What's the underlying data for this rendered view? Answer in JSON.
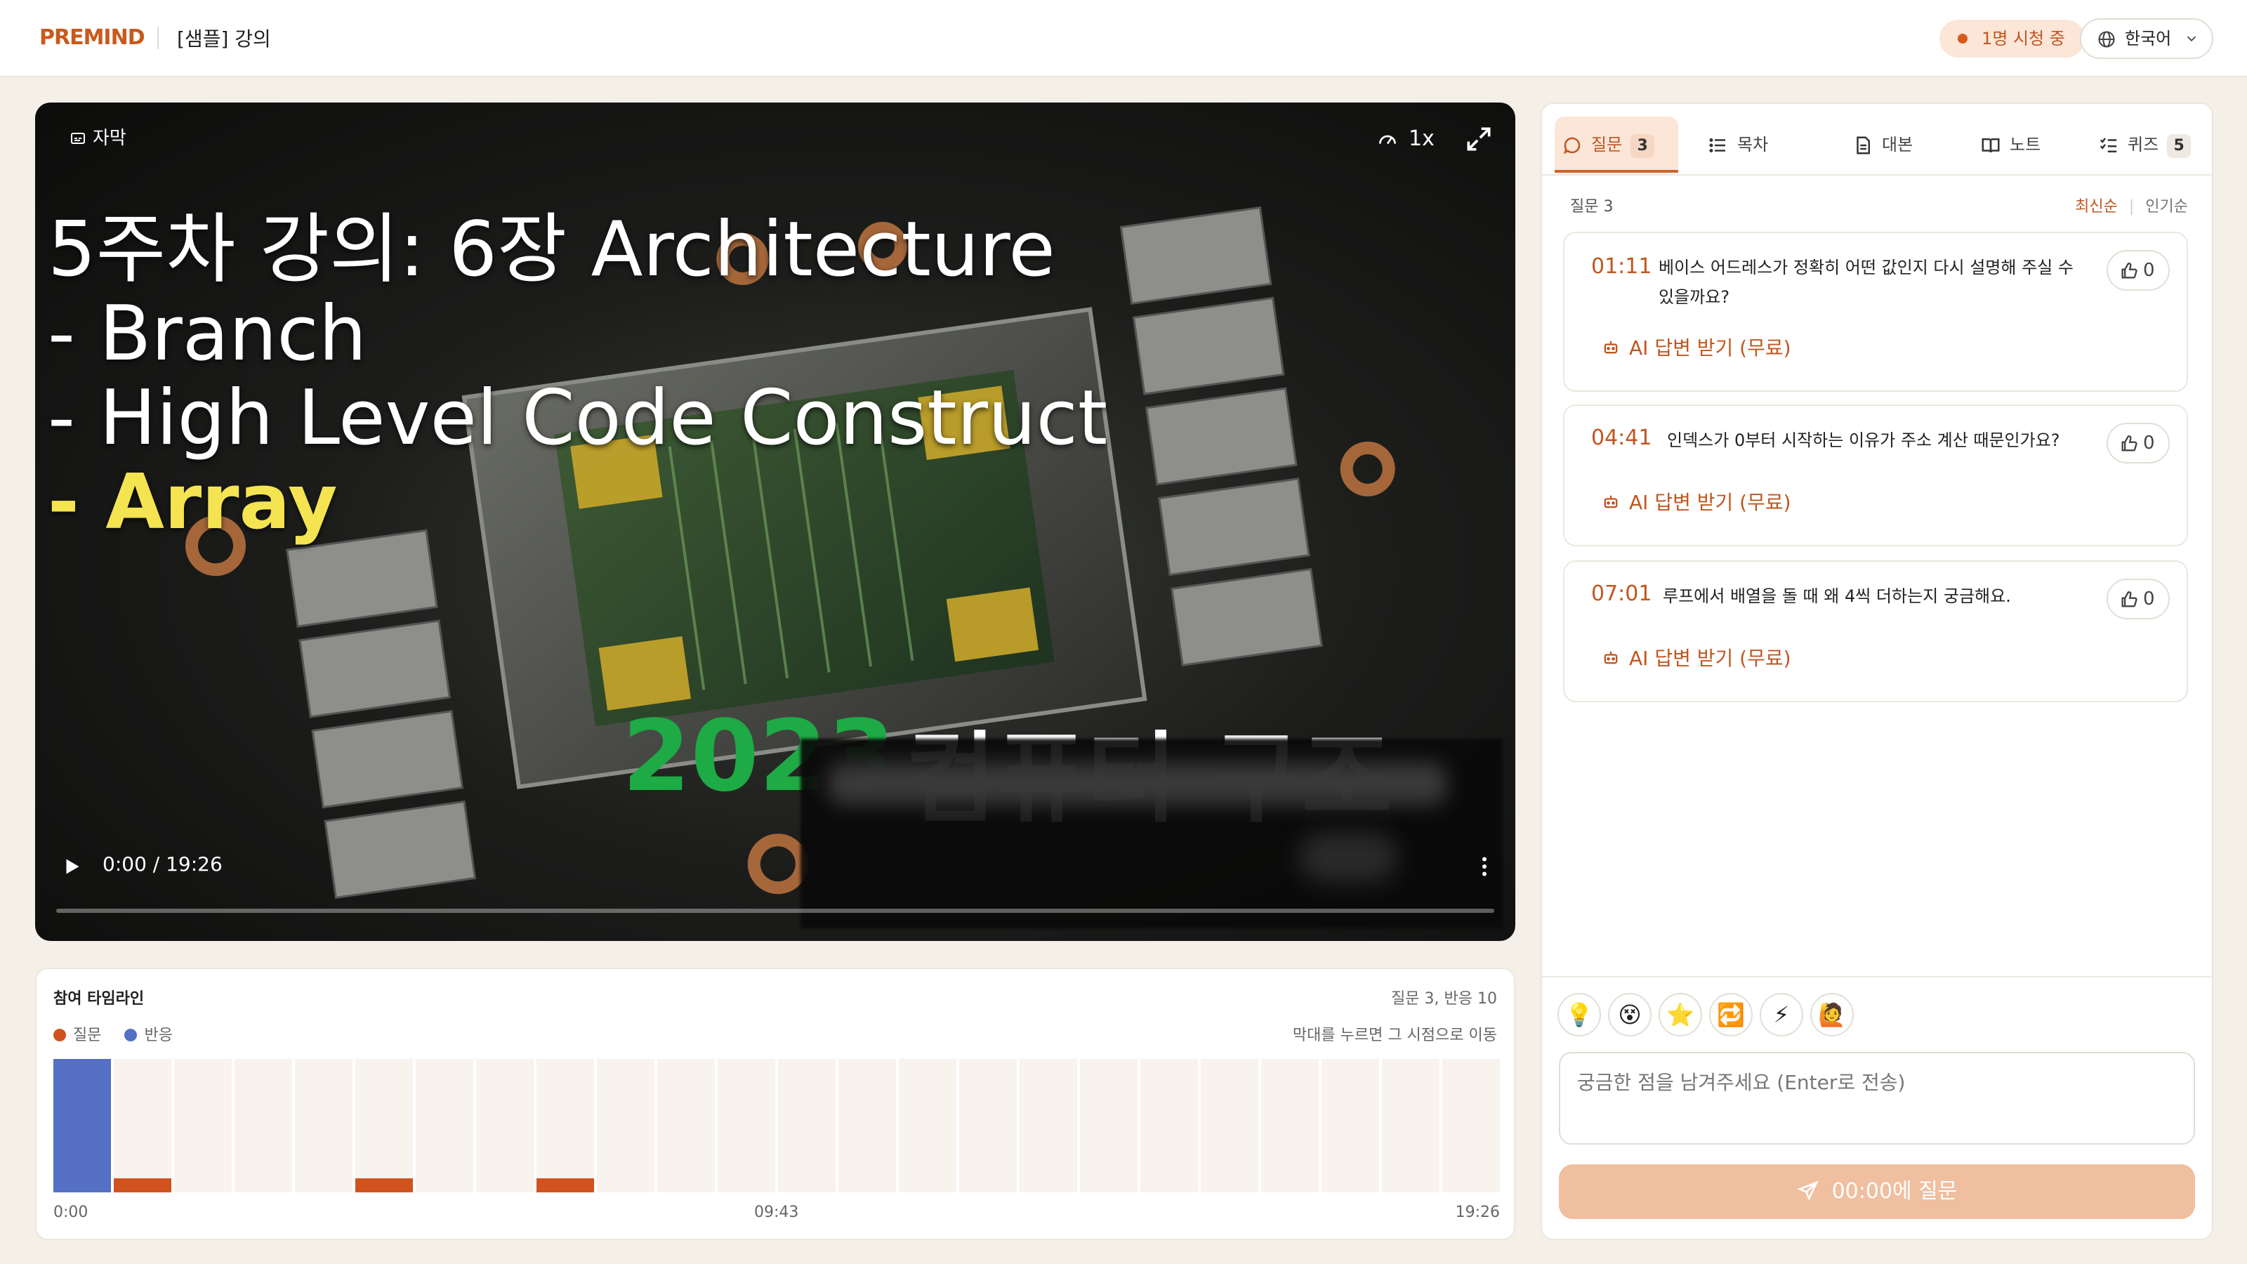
{
  "header": {
    "brand": "PREMIND",
    "course_title": "[샘플] 강의",
    "live_status": "1명 시청 중",
    "language": "한국어"
  },
  "video": {
    "subtitle_toggle": "자막",
    "speed": "1x",
    "time": "0:00 / 19:26",
    "progress": 0.0,
    "slide": {
      "lines": [
        "5주차 강의: 6장 Architecture",
        " - Branch",
        " - High Level Code Construct",
        " - Array"
      ],
      "year": "2023",
      "course": "컴퓨터 구조"
    }
  },
  "timeline": {
    "title": "참여 타임라인",
    "summary": "질문 3, 반응 10",
    "legend": [
      "질문",
      "반응"
    ],
    "hint": "막대를 누르면 그 시점으로 이동",
    "colors": {
      "question": "#d0531f",
      "reaction": "#5570c4"
    },
    "ticks": [
      "0:00",
      "09:43",
      "19:26"
    ]
  },
  "chart_data": {
    "type": "bar",
    "title": "참여 타임라인",
    "categories": [
      "0",
      "1",
      "2",
      "3",
      "4",
      "5",
      "6",
      "7",
      "8",
      "9",
      "10",
      "11",
      "12",
      "13",
      "14",
      "15",
      "16",
      "17",
      "18",
      "19",
      "20",
      "21",
      "22",
      "23"
    ],
    "series": [
      {
        "name": "질문",
        "values": [
          0,
          1,
          0,
          0,
          0,
          1,
          0,
          0,
          1,
          0,
          0,
          0,
          0,
          0,
          0,
          0,
          0,
          0,
          0,
          0,
          0,
          0,
          0,
          0
        ]
      },
      {
        "name": "반응",
        "values": [
          10,
          0,
          0,
          0,
          0,
          0,
          0,
          0,
          0,
          0,
          0,
          0,
          0,
          0,
          0,
          0,
          0,
          0,
          0,
          0,
          0,
          0,
          0,
          0
        ]
      }
    ],
    "x_ticks": [
      "0:00",
      "09:43",
      "19:26"
    ],
    "ylim": [
      0,
      10
    ],
    "legend_position": "top-left"
  },
  "panel": {
    "tabs": [
      {
        "label": "질문",
        "badge": "3",
        "icon": "chat-bubble-icon"
      },
      {
        "label": "목차",
        "badge": "",
        "icon": "list-icon"
      },
      {
        "label": "대본",
        "badge": "",
        "icon": "document-icon"
      },
      {
        "label": "노트",
        "badge": "",
        "icon": "book-icon"
      },
      {
        "label": "퀴즈",
        "badge": "5",
        "icon": "checklist-icon"
      }
    ],
    "question_count": "질문 3",
    "sort": {
      "active": "최신순",
      "other": "인기순"
    },
    "questions": [
      {
        "time": "01:11",
        "text": "베이스 어드레스가 정확히 어떤 값인지 다시 설명해 주실 수 있을까요?",
        "likes": "0",
        "ai_label": "AI 답변 받기 (무료)"
      },
      {
        "time": "04:41",
        "text": "인덱스가 0부터 시작하는 이유가 주소 계산 때문인가요?",
        "likes": "0",
        "ai_label": "AI 답변 받기 (무료)"
      },
      {
        "time": "07:01",
        "text": "루프에서 배열을 돌 때 왜 4씩 더하는지 궁금해요.",
        "likes": "0",
        "ai_label": "AI 답변 받기 (무료)"
      }
    ],
    "reactions": [
      "💡",
      "😵",
      "⭐",
      "🔁",
      "⚡",
      "🙋"
    ],
    "input_placeholder": "궁금한 점을 남겨주세요 (Enter로 전송)",
    "submit_label": "00:00에 질문"
  }
}
